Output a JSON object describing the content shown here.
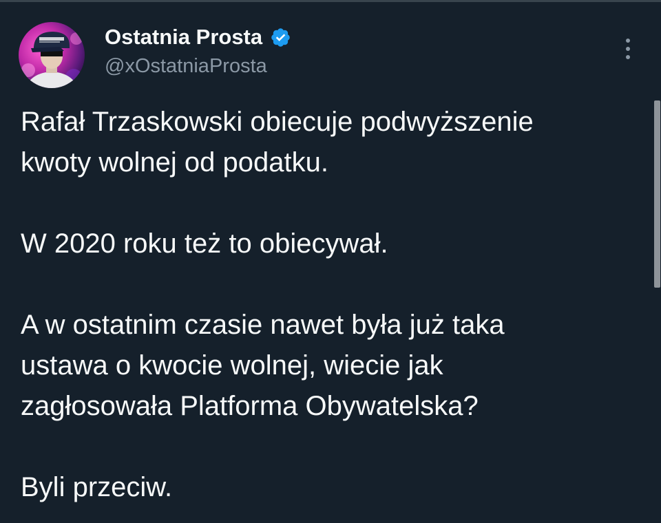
{
  "tweet": {
    "author": {
      "display_name": "Ostatnia Prosta",
      "handle": "@xOstatniaProsta",
      "verified": true,
      "verified_badge_icon": "verified-check-icon",
      "avatar_icon": "avatar-portrait-cap"
    },
    "more_icon": "more-vertical-dots-icon",
    "paragraphs": [
      "Rafał Trzaskowski obiecuje podwyższenie\nkwoty wolnej od podatku.",
      "W 2020 roku też to obiecywał.",
      "A w ostatnim czasie nawet była już taka\nustawa o kwocie wolnej, wiecie jak\nzagłosowała Platforma Obywatelska?",
      "Byli przeciw."
    ]
  },
  "colors": {
    "background": "#15202b",
    "text_primary": "#f7f9f9",
    "text_secondary": "#8b98a5",
    "verified_blue": "#1d9bf0",
    "scrollbar": "#8e949a"
  }
}
